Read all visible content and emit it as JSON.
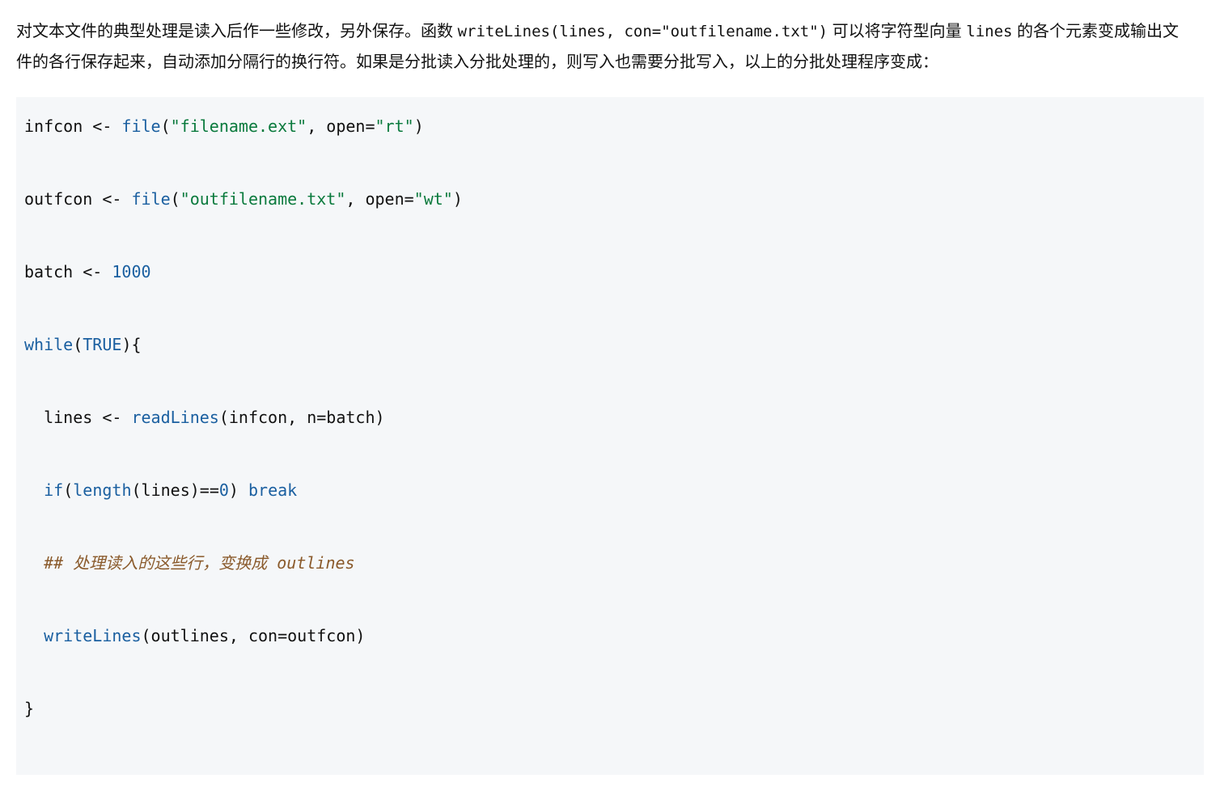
{
  "paragraph": {
    "t1": "对文本文件的典型处理是读入后作一些修改，另外保存。函数 ",
    "c1": "writeLines(lines, con=\"outfilename.txt\")",
    "t2": " 可以将字符型向量 ",
    "c2": "lines",
    "t3": " 的各个元素变成输出文件的各行保存起来，自动添加分隔行的换行符。如果是分批读入分批处理的，则写入也需要分批写入，以上的分批处理程序变成："
  },
  "code": {
    "l1": {
      "p1": "infcon <- ",
      "fn": "file",
      "p2": "(",
      "s1": "\"filename.ext\"",
      "p3": ", open=",
      "s2": "\"rt\"",
      "p4": ")"
    },
    "l2": {
      "p1": "outfcon <- ",
      "fn": "file",
      "p2": "(",
      "s1": "\"outfilename.txt\"",
      "p3": ", open=",
      "s2": "\"wt\"",
      "p4": ")"
    },
    "l3": {
      "p1": "batch <- ",
      "n1": "1000"
    },
    "l4": {
      "kw1": "while",
      "p1": "(",
      "kw2": "TRUE",
      "p2": "){"
    },
    "l5": {
      "p1": "  lines <- ",
      "fn": "readLines",
      "p2": "(infcon, n=batch)"
    },
    "l6": {
      "p1": "  ",
      "kw1": "if",
      "p2": "(",
      "fn": "length",
      "p3": "(lines)==",
      "n1": "0",
      "p4": ") ",
      "kw2": "break"
    },
    "l7": {
      "p1": "  ",
      "c1": "## 处理读入的这些行，变换成 outlines"
    },
    "l8": {
      "p1": "  ",
      "fn": "writeLines",
      "p2": "(outlines, con=outfcon)"
    },
    "l9": {
      "p1": "}"
    }
  }
}
